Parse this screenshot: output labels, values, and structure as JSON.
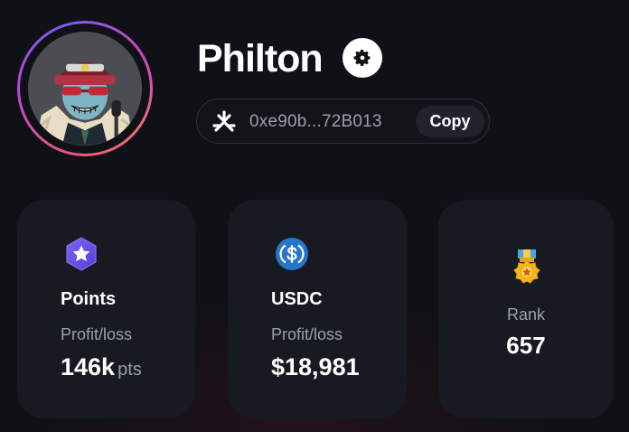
{
  "profile": {
    "username": "Philton",
    "avatar_icon": "avatar-character-icon",
    "settings_icon": "gear-icon",
    "wallet": {
      "icon": "wallet-network-icon",
      "address": "0xe90b...72B013",
      "copy_label": "Copy"
    }
  },
  "stats": {
    "points": {
      "icon": "star-hexagon-icon",
      "title": "Points",
      "subtitle": "Profit/loss",
      "value": "146k",
      "unit": "pts"
    },
    "usdc": {
      "icon": "usdc-coin-icon",
      "title": "USDC",
      "subtitle": "Profit/loss",
      "value": "$18,981"
    },
    "rank": {
      "icon": "medal-icon",
      "label": "Rank",
      "value": "657"
    }
  },
  "colors": {
    "background": "#0f1116",
    "card": "#171a21",
    "muted_text": "#9aa0ab",
    "points_accent": "#6a4fe6",
    "usdc_accent": "#2775ca",
    "medal_gold": "#f5b81d",
    "avatar_ring_start": "#e9567a",
    "avatar_ring_end": "#7b5cf0"
  }
}
